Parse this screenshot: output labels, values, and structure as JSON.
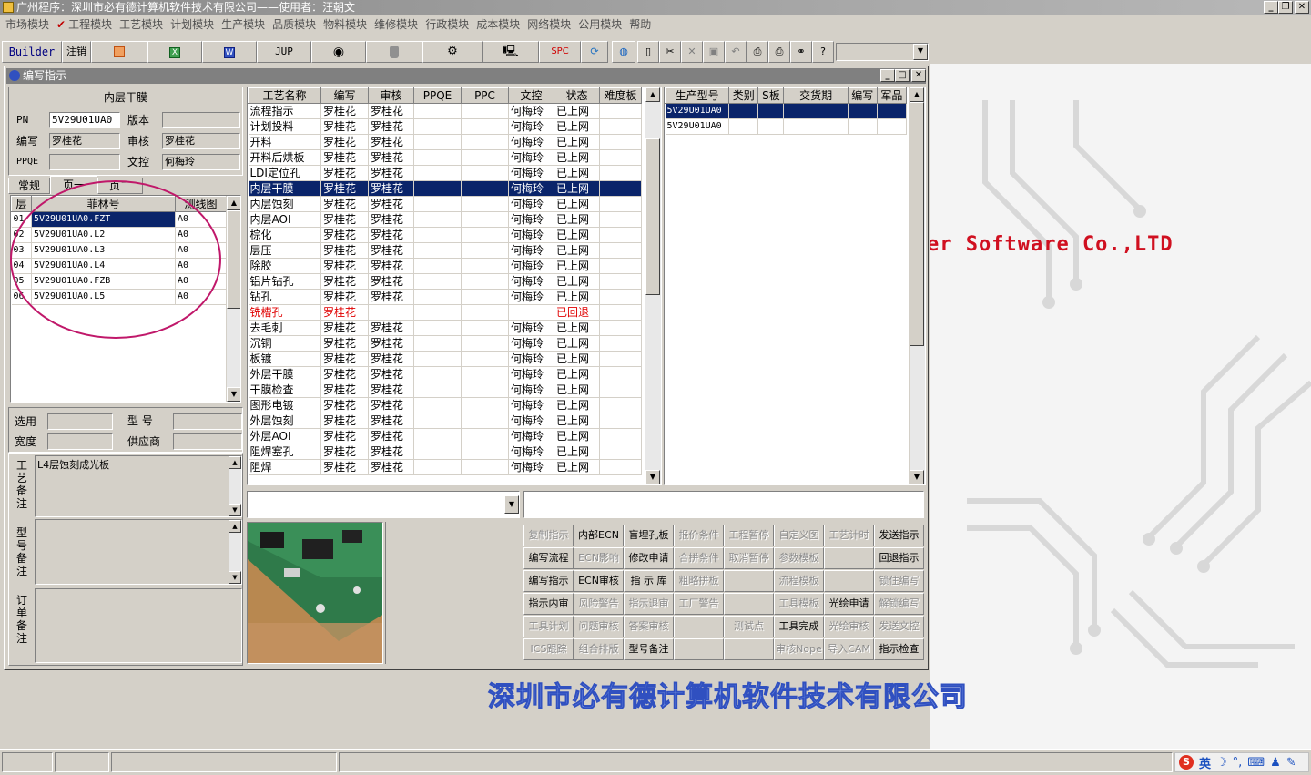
{
  "app": {
    "title": "广州程序：深圳市必有德计算机软件技术有限公司——使用者：汪朝文"
  },
  "menu": [
    {
      "label": "市场模块",
      "checked": false
    },
    {
      "label": "工程模块",
      "checked": true
    },
    {
      "label": "工艺模块",
      "checked": false
    },
    {
      "label": "计划模块",
      "checked": false
    },
    {
      "label": "生产模块",
      "checked": false
    },
    {
      "label": "品质模块",
      "checked": false
    },
    {
      "label": "物料模块",
      "checked": false
    },
    {
      "label": "维修模块",
      "checked": false
    },
    {
      "label": "行政模块",
      "checked": false
    },
    {
      "label": "成本模块",
      "checked": false
    },
    {
      "label": "网络模块",
      "checked": false
    },
    {
      "label": "公用模块",
      "checked": false
    },
    {
      "label": "帮助",
      "checked": false
    }
  ],
  "toolbar": {
    "builder": "Builder",
    "logout": "注销",
    "jup": "JUP",
    "spc": "SPC",
    "combo_value": ""
  },
  "window": {
    "title": "编写指示"
  },
  "process_panel": {
    "title": "内层干膜",
    "pn_label": "PN",
    "pn_value": "5V29U01UA0",
    "version_label": "版本",
    "version_value": "",
    "writer_label": "编写",
    "writer_value": "罗桂花",
    "reviewer_label": "审核",
    "reviewer_value": "罗桂花",
    "ppqe_label": "PPQE",
    "ppqe_value": "",
    "doc_label": "文控",
    "doc_value": "何梅玲"
  },
  "tabs": [
    "常规",
    "页一",
    "页二"
  ],
  "film_table": {
    "headers": [
      "层",
      "菲林号",
      "测线图"
    ],
    "rows": [
      [
        "01",
        "5V29U01UA0.FZT",
        "A0"
      ],
      [
        "02",
        "5V29U01UA0.L2",
        "A0"
      ],
      [
        "03",
        "5V29U01UA0.L3",
        "A0"
      ],
      [
        "04",
        "5V29U01UA0.L4",
        "A0"
      ],
      [
        "05",
        "5V29U01UA0.FZB",
        "A0"
      ],
      [
        "06",
        "5V29U01UA0.L5",
        "A0"
      ]
    ]
  },
  "misc_fields": {
    "select_label": "选用",
    "select_value": "",
    "model_label": "型  号",
    "model_value": "",
    "width_label": "宽度",
    "width_value": "",
    "supplier_label": "供应商",
    "supplier_value": ""
  },
  "notes": {
    "process_label": "工艺备注",
    "process_value": "L4层蚀刻成光板",
    "model_label": "型号备注",
    "model_value": "",
    "order_label": "订单备注",
    "order_value": ""
  },
  "process_table": {
    "headers": [
      "工艺名称",
      "编写",
      "审核",
      "PPQE",
      "PPC",
      "文控",
      "状态",
      "难度板"
    ],
    "rows": [
      {
        "cells": [
          "流程指示",
          "罗桂花",
          "罗桂花",
          "",
          "",
          "何梅玲",
          "已上网",
          ""
        ],
        "state": "normal"
      },
      {
        "cells": [
          "计划投料",
          "罗桂花",
          "罗桂花",
          "",
          "",
          "何梅玲",
          "已上网",
          ""
        ],
        "state": "normal"
      },
      {
        "cells": [
          "开料",
          "罗桂花",
          "罗桂花",
          "",
          "",
          "何梅玲",
          "已上网",
          ""
        ],
        "state": "normal"
      },
      {
        "cells": [
          "开料后烘板",
          "罗桂花",
          "罗桂花",
          "",
          "",
          "何梅玲",
          "已上网",
          ""
        ],
        "state": "normal"
      },
      {
        "cells": [
          "LDI定位孔",
          "罗桂花",
          "罗桂花",
          "",
          "",
          "何梅玲",
          "已上网",
          ""
        ],
        "state": "normal"
      },
      {
        "cells": [
          "内层干膜",
          "罗桂花",
          "罗桂花",
          "",
          "",
          "何梅玲",
          "已上网",
          ""
        ],
        "state": "selected"
      },
      {
        "cells": [
          "内层蚀刻",
          "罗桂花",
          "罗桂花",
          "",
          "",
          "何梅玲",
          "已上网",
          ""
        ],
        "state": "normal"
      },
      {
        "cells": [
          "内层AOI",
          "罗桂花",
          "罗桂花",
          "",
          "",
          "何梅玲",
          "已上网",
          ""
        ],
        "state": "normal"
      },
      {
        "cells": [
          "棕化",
          "罗桂花",
          "罗桂花",
          "",
          "",
          "何梅玲",
          "已上网",
          ""
        ],
        "state": "normal"
      },
      {
        "cells": [
          "层压",
          "罗桂花",
          "罗桂花",
          "",
          "",
          "何梅玲",
          "已上网",
          ""
        ],
        "state": "normal"
      },
      {
        "cells": [
          "除胶",
          "罗桂花",
          "罗桂花",
          "",
          "",
          "何梅玲",
          "已上网",
          ""
        ],
        "state": "normal"
      },
      {
        "cells": [
          "铝片钻孔",
          "罗桂花",
          "罗桂花",
          "",
          "",
          "何梅玲",
          "已上网",
          ""
        ],
        "state": "normal"
      },
      {
        "cells": [
          "钻孔",
          "罗桂花",
          "罗桂花",
          "",
          "",
          "何梅玲",
          "已上网",
          ""
        ],
        "state": "normal"
      },
      {
        "cells": [
          "铣槽孔",
          "罗桂花",
          "",
          "",
          "",
          "",
          "已回退",
          ""
        ],
        "state": "returned"
      },
      {
        "cells": [
          "去毛刺",
          "罗桂花",
          "罗桂花",
          "",
          "",
          "何梅玲",
          "已上网",
          ""
        ],
        "state": "normal"
      },
      {
        "cells": [
          "沉铜",
          "罗桂花",
          "罗桂花",
          "",
          "",
          "何梅玲",
          "已上网",
          ""
        ],
        "state": "normal"
      },
      {
        "cells": [
          "板镀",
          "罗桂花",
          "罗桂花",
          "",
          "",
          "何梅玲",
          "已上网",
          ""
        ],
        "state": "normal"
      },
      {
        "cells": [
          "外层干膜",
          "罗桂花",
          "罗桂花",
          "",
          "",
          "何梅玲",
          "已上网",
          ""
        ],
        "state": "normal"
      },
      {
        "cells": [
          "干膜检查",
          "罗桂花",
          "罗桂花",
          "",
          "",
          "何梅玲",
          "已上网",
          ""
        ],
        "state": "normal"
      },
      {
        "cells": [
          "图形电镀",
          "罗桂花",
          "罗桂花",
          "",
          "",
          "何梅玲",
          "已上网",
          ""
        ],
        "state": "normal"
      },
      {
        "cells": [
          "外层蚀刻",
          "罗桂花",
          "罗桂花",
          "",
          "",
          "何梅玲",
          "已上网",
          ""
        ],
        "state": "normal"
      },
      {
        "cells": [
          "外层AOI",
          "罗桂花",
          "罗桂花",
          "",
          "",
          "何梅玲",
          "已上网",
          ""
        ],
        "state": "normal"
      },
      {
        "cells": [
          "阻焊塞孔",
          "罗桂花",
          "罗桂花",
          "",
          "",
          "何梅玲",
          "已上网",
          ""
        ],
        "state": "normal"
      },
      {
        "cells": [
          "阻焊",
          "罗桂花",
          "罗桂花",
          "",
          "",
          "何梅玲",
          "已上网",
          ""
        ],
        "state": "normal"
      }
    ]
  },
  "model_table": {
    "headers": [
      "生产型号",
      "类别",
      "S板",
      "交货期",
      "编写",
      "军品"
    ],
    "rows": [
      {
        "cells": [
          "5V29U01UA0",
          "",
          "",
          "",
          "",
          ""
        ],
        "state": "selected"
      },
      {
        "cells": [
          "5V29U01UA0",
          "",
          "",
          "",
          "",
          ""
        ],
        "state": "normal"
      }
    ]
  },
  "inputs": {
    "left_combo": "",
    "right_text": ""
  },
  "action_buttons": [
    [
      {
        "label": "复制指示",
        "enabled": false
      },
      {
        "label": "内部ECN",
        "enabled": true
      },
      {
        "label": "盲埋孔板",
        "enabled": true
      },
      {
        "label": "报价条件",
        "enabled": false
      },
      {
        "label": "工程暂停",
        "enabled": false
      },
      {
        "label": "自定义图",
        "enabled": false
      },
      {
        "label": "工艺计时",
        "enabled": false
      },
      {
        "label": "发送指示",
        "enabled": true
      }
    ],
    [
      {
        "label": "编写流程",
        "enabled": true
      },
      {
        "label": "ECN影响",
        "enabled": false
      },
      {
        "label": "修改申请",
        "enabled": true
      },
      {
        "label": "合拼条件",
        "enabled": false
      },
      {
        "label": "取消暂停",
        "enabled": false
      },
      {
        "label": "参数模板",
        "enabled": false
      },
      {
        "label": "",
        "enabled": false
      },
      {
        "label": "回退指示",
        "enabled": true
      }
    ],
    [
      {
        "label": "编写指示",
        "enabled": true
      },
      {
        "label": "ECN审核",
        "enabled": true
      },
      {
        "label": "指 示 库",
        "enabled": true
      },
      {
        "label": "粗略拼板",
        "enabled": false
      },
      {
        "label": "",
        "enabled": false
      },
      {
        "label": "流程模板",
        "enabled": false
      },
      {
        "label": "",
        "enabled": false
      },
      {
        "label": "锁住编写",
        "enabled": false
      }
    ],
    [
      {
        "label": "指示内审",
        "enabled": true
      },
      {
        "label": "风险警告",
        "enabled": false
      },
      {
        "label": "指示退审",
        "enabled": false
      },
      {
        "label": "工厂警告",
        "enabled": false
      },
      {
        "label": "",
        "enabled": false
      },
      {
        "label": "工具模板",
        "enabled": false
      },
      {
        "label": "光绘申请",
        "enabled": true
      },
      {
        "label": "解锁编写",
        "enabled": false
      }
    ],
    [
      {
        "label": "工具计划",
        "enabled": false
      },
      {
        "label": "问题审核",
        "enabled": false
      },
      {
        "label": "答案审核",
        "enabled": false
      },
      {
        "label": "",
        "enabled": false
      },
      {
        "label": "测试点",
        "enabled": false
      },
      {
        "label": "工具完成",
        "enabled": true
      },
      {
        "label": "光绘审核",
        "enabled": false
      },
      {
        "label": "发送文控",
        "enabled": false
      }
    ],
    [
      {
        "label": "ICS跟踪",
        "enabled": false
      },
      {
        "label": "组合排版",
        "enabled": false
      },
      {
        "label": "型号备注",
        "enabled": true
      },
      {
        "label": "",
        "enabled": false
      },
      {
        "label": "",
        "enabled": false
      },
      {
        "label": "审核Nope",
        "enabled": false
      },
      {
        "label": "导入CAM",
        "enabled": false
      },
      {
        "label": "指示检查",
        "enabled": true
      }
    ]
  ],
  "background": {
    "company_en": "er Software Co.,LTD",
    "company_cn": "深圳市必有德计算机软件技术有限公司"
  },
  "tray": {
    "ime_lang": "英"
  },
  "colors": {
    "selection": "#0a246a",
    "returned": "#e00000",
    "annotation_circle": "#c0186a",
    "brand_text": "#d01020",
    "brand_cn": "#8aa8f0"
  }
}
